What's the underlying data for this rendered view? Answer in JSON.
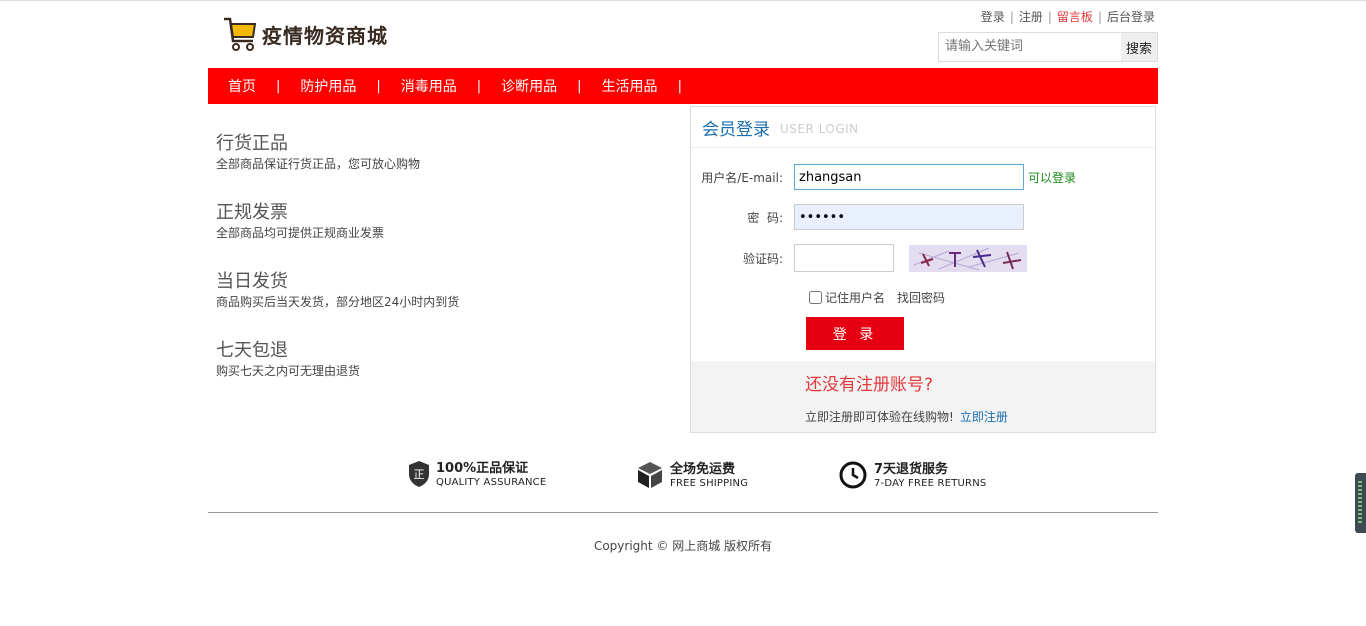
{
  "header": {
    "logo_text": "疫情物资商城",
    "links": {
      "login": "登录",
      "register": "注册",
      "message_board": "留言板",
      "admin_login": "后台登录",
      "separator": "|"
    },
    "search": {
      "placeholder": "请输入关键词",
      "button": "搜索"
    }
  },
  "nav": {
    "items": [
      "首页",
      "防护用品",
      "消毒用品",
      "诊断用品",
      "生活用品"
    ],
    "separator": "|"
  },
  "features": [
    {
      "title": "行货正品",
      "desc": "全部商品保证行货正品，您可放心购物"
    },
    {
      "title": "正规发票",
      "desc": "全部商品均可提供正规商业发票"
    },
    {
      "title": "当日发货",
      "desc": "商品购买后当天发货，部分地区24小时内到货"
    },
    {
      "title": "七天包退",
      "desc": "购买七天之内可无理由退货"
    }
  ],
  "login": {
    "title": "会员登录",
    "title_en": "USER LOGIN",
    "username_label": "用户名/E-mail:",
    "username_value": "zhangsan",
    "username_status": "可以登录",
    "password_label": "密  码:",
    "password_value": "••••••",
    "captcha_label": "验证码:",
    "captcha_value": "",
    "remember_label": "记住用户名",
    "forgot_label": "找回密码",
    "login_button": "登 录",
    "no_account": "还没有注册账号?",
    "register_desc": "立即注册即可体验在线购物!",
    "register_link": "立即注册"
  },
  "services": [
    {
      "title": "100%正品保证",
      "subtitle": "QUALITY ASSURANCE",
      "icon": "shield-icon"
    },
    {
      "title": "全场免运费",
      "subtitle": "FREE SHIPPING",
      "icon": "box-icon"
    },
    {
      "title": "7天退货服务",
      "subtitle": "7-DAY FREE RETURNS",
      "icon": "clock-icon"
    }
  ],
  "footer": {
    "copyright": "Copyright © 网上商城 版权所有"
  },
  "colors": {
    "nav_red": "#ff0000",
    "button_red": "#e50012",
    "link_blue": "#1a6fb0",
    "status_green": "#1a8a1a"
  }
}
